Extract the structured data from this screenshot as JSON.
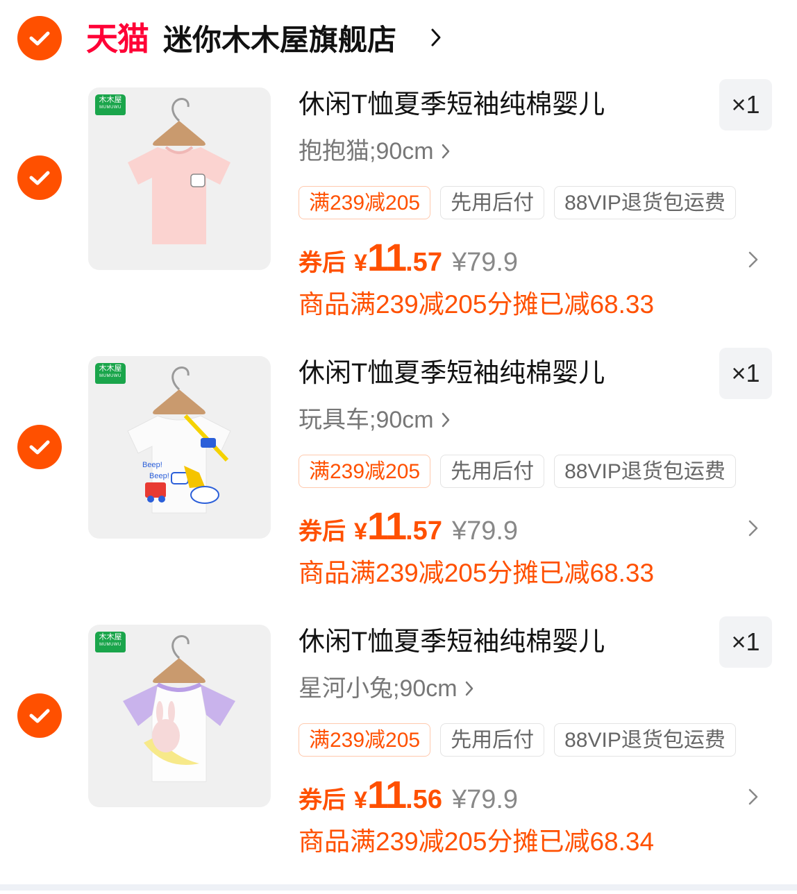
{
  "store": {
    "platform_logo": "天猫",
    "name": "迷你木木屋旗舰店",
    "brand_color": "#ff0036",
    "chevron_icon": "chevron-right-icon"
  },
  "accent_color": "#ff5000",
  "items": [
    {
      "brand_badge": "木木屋",
      "brand_badge_sub": "MUMUWU",
      "title": "休闲T恤夏季短袖纯棉婴儿",
      "qty": "×1",
      "sku": "抱抱猫;90cm",
      "tags": [
        "满239减205",
        "先用后付",
        "88VIP退货包运费"
      ],
      "price_label": "券后",
      "currency": "¥",
      "price_int": "11",
      "price_dec": ".57",
      "orig_price": "¥79.9",
      "alloc": "商品满239减205分摊已减68.33",
      "image_desc": "pink-tshirt"
    },
    {
      "brand_badge": "木木屋",
      "brand_badge_sub": "MUMUWU",
      "title": "休闲T恤夏季短袖纯棉婴儿",
      "qty": "×1",
      "sku": "玩具车;90cm",
      "tags": [
        "满239减205",
        "先用后付",
        "88VIP退货包运费"
      ],
      "price_label": "券后",
      "currency": "¥",
      "price_int": "11",
      "price_dec": ".57",
      "orig_price": "¥79.9",
      "alloc": "商品满239减205分摊已减68.33",
      "image_desc": "white-car-tshirt"
    },
    {
      "brand_badge": "木木屋",
      "brand_badge_sub": "MUMUWU",
      "title": "休闲T恤夏季短袖纯棉婴儿",
      "qty": "×1",
      "sku": "星河小兔;90cm",
      "tags": [
        "满239减205",
        "先用后付",
        "88VIP退货包运费"
      ],
      "price_label": "券后",
      "currency": "¥",
      "price_int": "11",
      "price_dec": ".56",
      "orig_price": "¥79.9",
      "alloc": "商品满239减205分摊已减68.34",
      "image_desc": "purple-bunny-tshirt"
    }
  ]
}
